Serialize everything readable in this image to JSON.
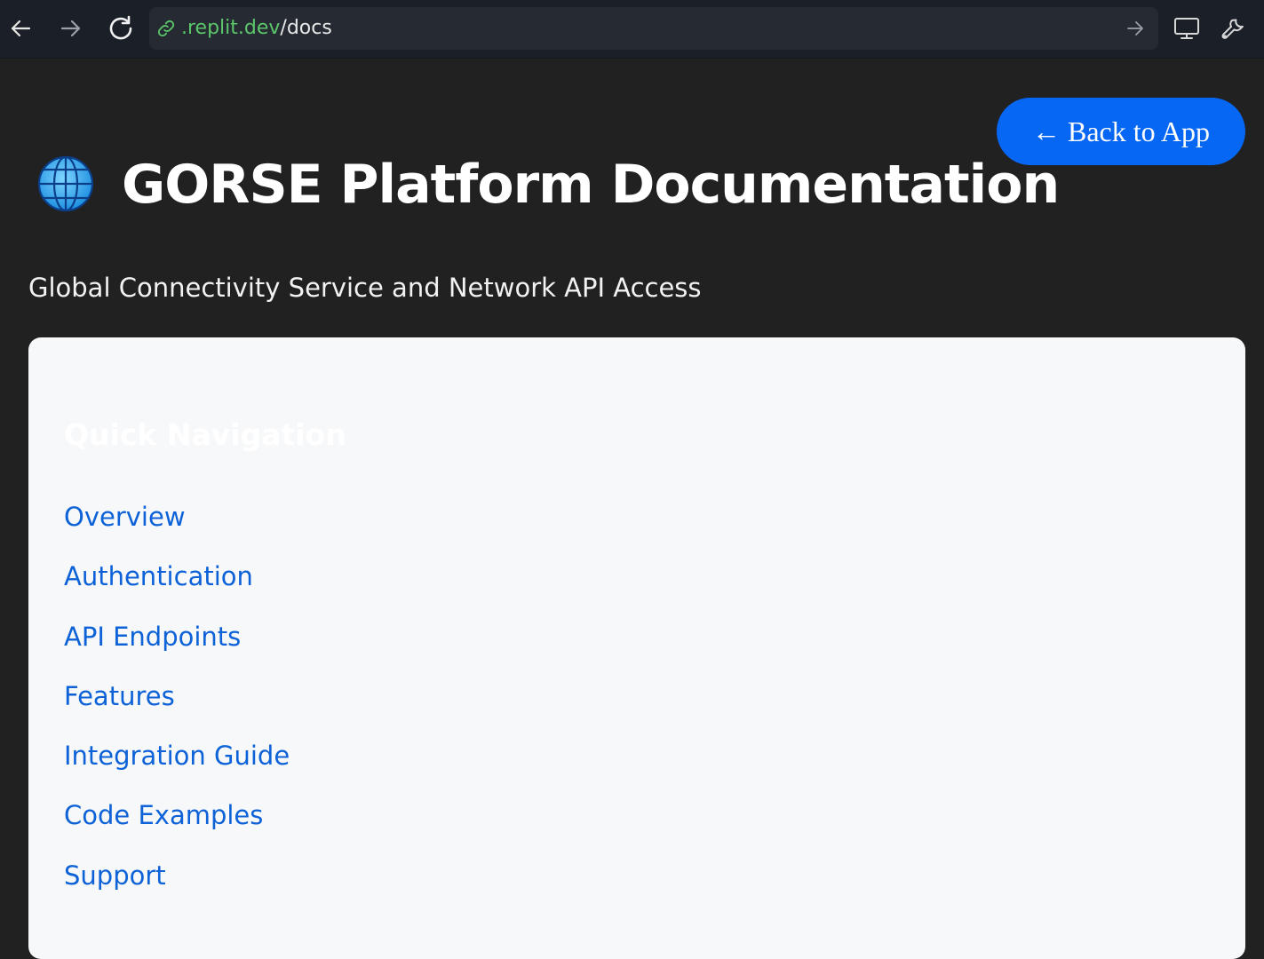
{
  "browser": {
    "url_domain": ".replit.dev",
    "url_path": "/docs",
    "icons": {
      "back": "back-arrow-icon",
      "forward": "forward-arrow-icon",
      "reload": "reload-icon",
      "link": "link-icon",
      "go": "go-arrow-icon",
      "device": "monitor-icon",
      "tools": "wrench-icon"
    }
  },
  "page": {
    "back_button_label": "← Back to App",
    "title_icon": "globe-icon",
    "title": "GORSE Platform Documentation",
    "subtitle": "Global Connectivity Service and Network API Access"
  },
  "nav": {
    "heading": "Quick Navigation",
    "items": [
      {
        "label": "Overview"
      },
      {
        "label": "Authentication"
      },
      {
        "label": "API Endpoints"
      },
      {
        "label": "Features"
      },
      {
        "label": "Integration Guide"
      },
      {
        "label": "Code Examples"
      },
      {
        "label": "Support"
      }
    ]
  },
  "colors": {
    "page_background": "#212121",
    "toolbar_background": "#1b1f27",
    "accent_button": "#0767f5",
    "link": "#0d62d8",
    "card_background": "#f7f8fa",
    "url_domain": "#5cc66a"
  }
}
